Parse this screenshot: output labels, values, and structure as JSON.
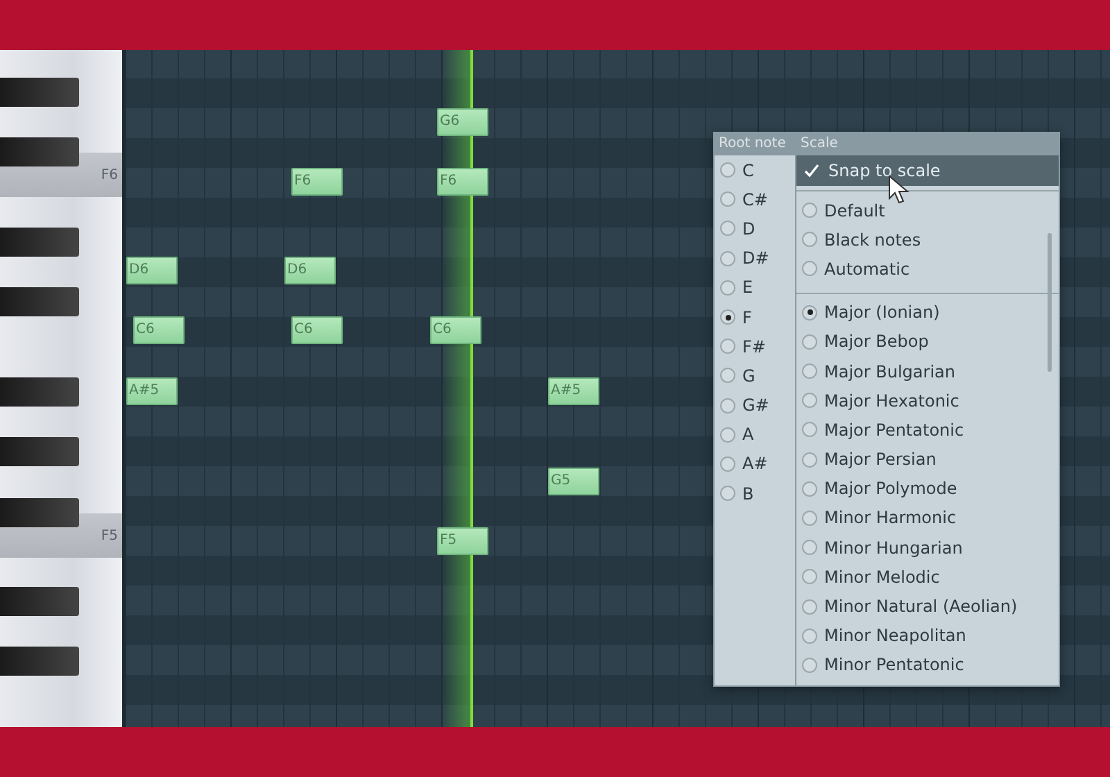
{
  "piano_keys": [
    {
      "label": "F6"
    },
    {
      "label": "F5"
    }
  ],
  "notes": [
    {
      "label": "G6"
    },
    {
      "label": "F6"
    },
    {
      "label": "F6"
    },
    {
      "label": "D6"
    },
    {
      "label": "D6"
    },
    {
      "label": "C6"
    },
    {
      "label": "C6"
    },
    {
      "label": "C6"
    },
    {
      "label": "A#5"
    },
    {
      "label": "A#5"
    },
    {
      "label": "G5"
    },
    {
      "label": "F5"
    }
  ],
  "root_note_menu": {
    "header": "Root note",
    "items": [
      {
        "label": "C",
        "selected": false
      },
      {
        "label": "C#",
        "selected": false
      },
      {
        "label": "D",
        "selected": false
      },
      {
        "label": "D#",
        "selected": false
      },
      {
        "label": "E",
        "selected": false
      },
      {
        "label": "F",
        "selected": true
      },
      {
        "label": "F#",
        "selected": false
      },
      {
        "label": "G",
        "selected": false
      },
      {
        "label": "G#",
        "selected": false
      },
      {
        "label": "A",
        "selected": false
      },
      {
        "label": "A#",
        "selected": false
      },
      {
        "label": "B",
        "selected": false
      }
    ]
  },
  "scale_menu": {
    "header": "Scale",
    "snap": {
      "label": "Snap to scale",
      "checked": true
    },
    "groups": [
      {
        "items": [
          {
            "label": "Default",
            "selected": false
          },
          {
            "label": "Black notes",
            "selected": false
          },
          {
            "label": "Automatic",
            "selected": false
          }
        ]
      },
      {
        "items": [
          {
            "label": "Major (Ionian)",
            "selected": true
          },
          {
            "label": "Major Bebop",
            "selected": false
          },
          {
            "label": "Major Bulgarian",
            "selected": false
          },
          {
            "label": "Major Hexatonic",
            "selected": false
          },
          {
            "label": "Major Pentatonic",
            "selected": false
          },
          {
            "label": "Major Persian",
            "selected": false
          },
          {
            "label": "Major Polymode",
            "selected": false
          },
          {
            "label": "Minor Harmonic",
            "selected": false
          },
          {
            "label": "Minor Hungarian",
            "selected": false
          },
          {
            "label": "Minor Melodic",
            "selected": false
          },
          {
            "label": "Minor Natural (Aeolian)",
            "selected": false
          },
          {
            "label": "Minor Neapolitan",
            "selected": false
          },
          {
            "label": "Minor Pentatonic",
            "selected": false
          }
        ]
      }
    ]
  }
}
